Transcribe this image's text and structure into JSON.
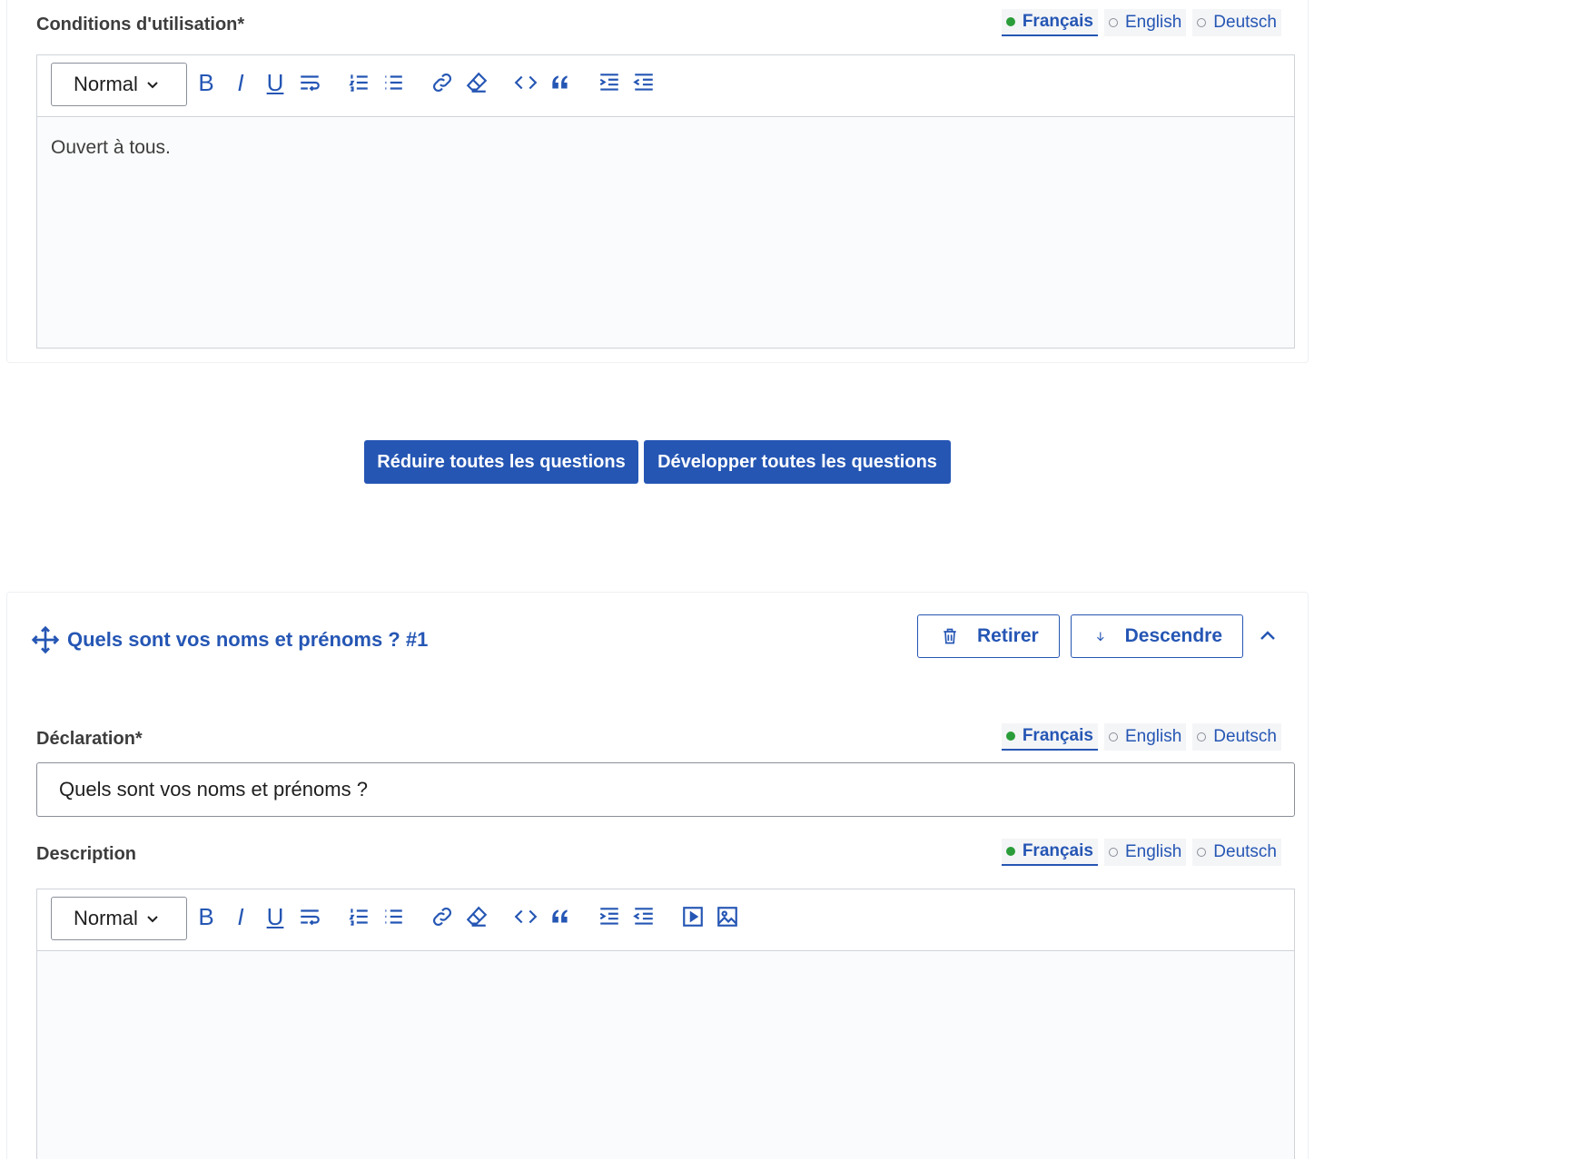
{
  "terms": {
    "label": "Conditions d'utilisation*",
    "content": "Ouvert à tous."
  },
  "languages": [
    {
      "label": "Français",
      "active": true
    },
    {
      "label": "English",
      "active": false
    },
    {
      "label": "Deutsch",
      "active": false
    }
  ],
  "editor": {
    "format_select": "Normal",
    "icons": [
      "bold-icon",
      "italic-icon",
      "underline-icon",
      "text-wrap-icon",
      "ordered-list-icon",
      "bullet-list-icon",
      "link-icon",
      "clear-format-icon",
      "code-icon",
      "quote-icon",
      "indent-icon",
      "outdent-icon",
      "video-icon",
      "image-icon"
    ]
  },
  "actions": {
    "collapse_all": "Réduire toutes les questions",
    "expand_all": "Développer toutes les questions"
  },
  "question": {
    "title": "Quels sont vos noms et prénoms ? #1",
    "remove_label": "Retirer",
    "move_down_label": "Descendre",
    "statement_label": "Déclaration*",
    "statement_value": "Quels sont vos noms et prénoms ?",
    "description_label": "Description",
    "description_value": ""
  },
  "colors": {
    "primary": "#2556b4",
    "active_dot": "#2a9d3a",
    "text": "#3d3d3d"
  }
}
